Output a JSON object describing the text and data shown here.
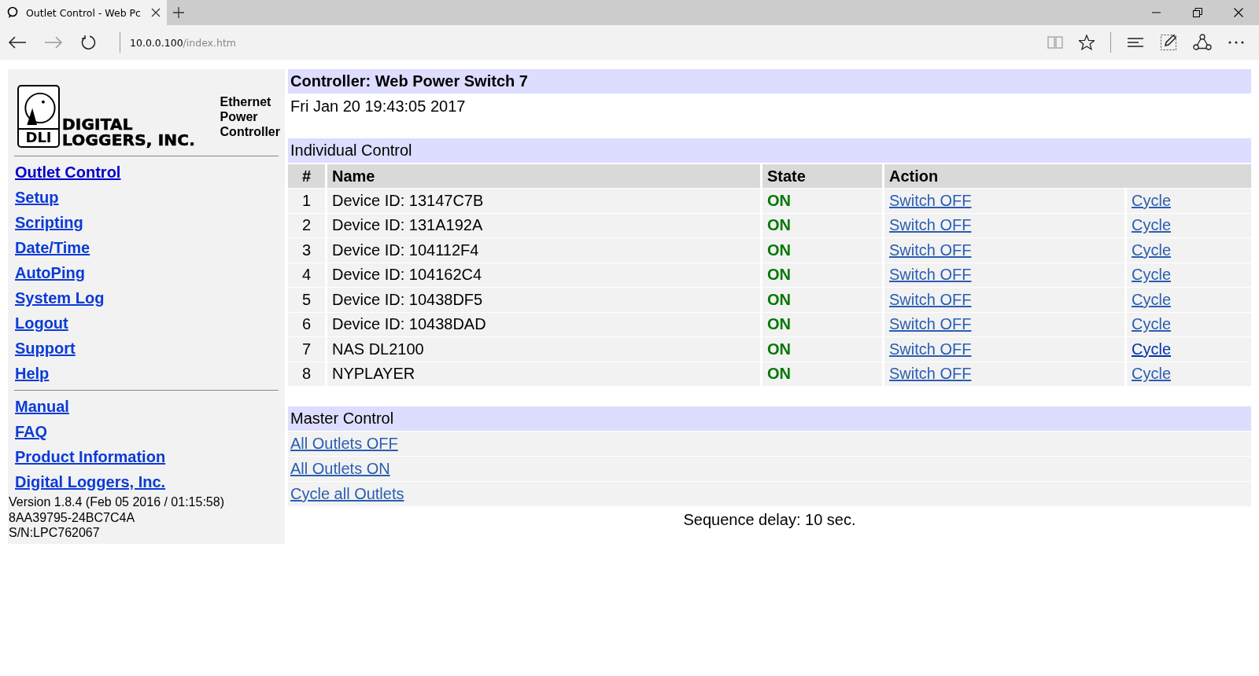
{
  "browser": {
    "tab_title": "Outlet Control - Web Pc",
    "url_host": "10.0.0.100",
    "url_path": "/index.htm"
  },
  "logo": {
    "badge": "DLI",
    "name_line_1": "DIGITAL",
    "name_line_2": "LOGGERS, INC.",
    "tagline": [
      "Ethernet",
      "Power",
      "Controller"
    ]
  },
  "sidebar": {
    "nav": [
      "Outlet Control",
      "Setup",
      "Scripting",
      "Date/Time",
      "AutoPing",
      "System Log",
      "Logout",
      "Support",
      "Help"
    ],
    "resources": [
      "Manual",
      "FAQ",
      "Product Information",
      "Digital Loggers, Inc."
    ],
    "version": [
      "Version 1.8.4 (Feb 05 2016 / 01:15:58)",
      "8AA39795-24BC7C4A",
      "S/N:LPC762067"
    ]
  },
  "controller_title": "Controller: Web Power Switch 7",
  "datetime": "Fri Jan 20 19:43:05 2017",
  "individual_control": {
    "title": "Individual Control",
    "columns": [
      "#",
      "Name",
      "State",
      "Action"
    ],
    "rows": [
      {
        "number": "1",
        "name": "Device ID: 13147C7B",
        "state": "ON",
        "switch": "Switch OFF",
        "cycle": "Cycle",
        "cycle_visited": false
      },
      {
        "number": "2",
        "name": "Device ID: 131A192A",
        "state": "ON",
        "switch": "Switch OFF",
        "cycle": "Cycle",
        "cycle_visited": false
      },
      {
        "number": "3",
        "name": "Device ID: 104112F4",
        "state": "ON",
        "switch": "Switch OFF",
        "cycle": "Cycle",
        "cycle_visited": false
      },
      {
        "number": "4",
        "name": "Device ID: 104162C4",
        "state": "ON",
        "switch": "Switch OFF",
        "cycle": "Cycle",
        "cycle_visited": false
      },
      {
        "number": "5",
        "name": "Device ID: 10438DF5",
        "state": "ON",
        "switch": "Switch OFF",
        "cycle": "Cycle",
        "cycle_visited": false
      },
      {
        "number": "6",
        "name": "Device ID: 10438DAD",
        "state": "ON",
        "switch": "Switch OFF",
        "cycle": "Cycle",
        "cycle_visited": false
      },
      {
        "number": "7",
        "name": "NAS DL2100",
        "state": "ON",
        "switch": "Switch OFF",
        "cycle": "Cycle",
        "cycle_visited": true
      },
      {
        "number": "8",
        "name": "NYPLAYER",
        "state": "ON",
        "switch": "Switch OFF",
        "cycle": "Cycle",
        "cycle_visited": false
      }
    ]
  },
  "master_control": {
    "title": "Master Control",
    "links": [
      "All Outlets OFF",
      "All Outlets ON",
      "Cycle all Outlets"
    ]
  },
  "sequence_delay": "Sequence delay: 10 sec."
}
